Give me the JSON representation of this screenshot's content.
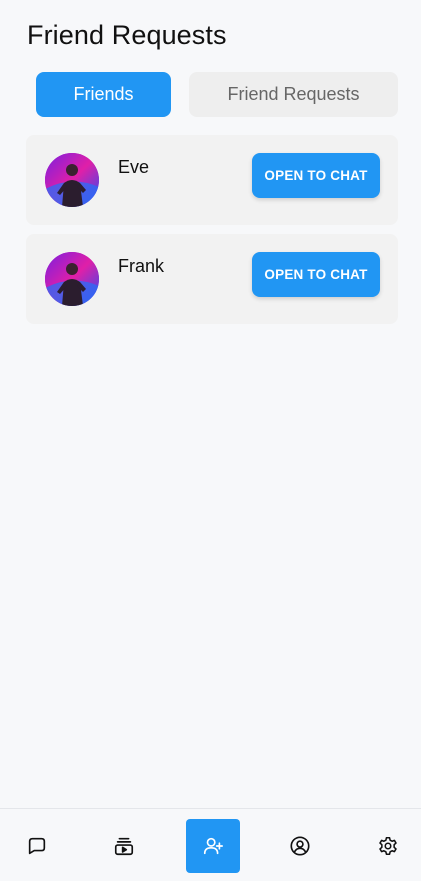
{
  "header": {
    "title": "Friend Requests"
  },
  "tabs": [
    {
      "label": "Friends",
      "active": true
    },
    {
      "label": "Friend Requests",
      "active": false
    }
  ],
  "friends": [
    {
      "name": "Eve",
      "button_label": "OPEN TO CHAT"
    },
    {
      "name": "Frank",
      "button_label": "OPEN TO CHAT"
    }
  ],
  "bottom_nav": [
    {
      "icon": "chat-bubble-icon",
      "active": false
    },
    {
      "icon": "media-icon",
      "active": false
    },
    {
      "icon": "add-user-icon",
      "active": true
    },
    {
      "icon": "profile-icon",
      "active": false
    },
    {
      "icon": "gear-icon",
      "active": false
    }
  ],
  "colors": {
    "accent": "#2196f3",
    "background": "#f7f8fa",
    "card": "#f2f2f2",
    "tab_inactive": "#eeeeee"
  }
}
